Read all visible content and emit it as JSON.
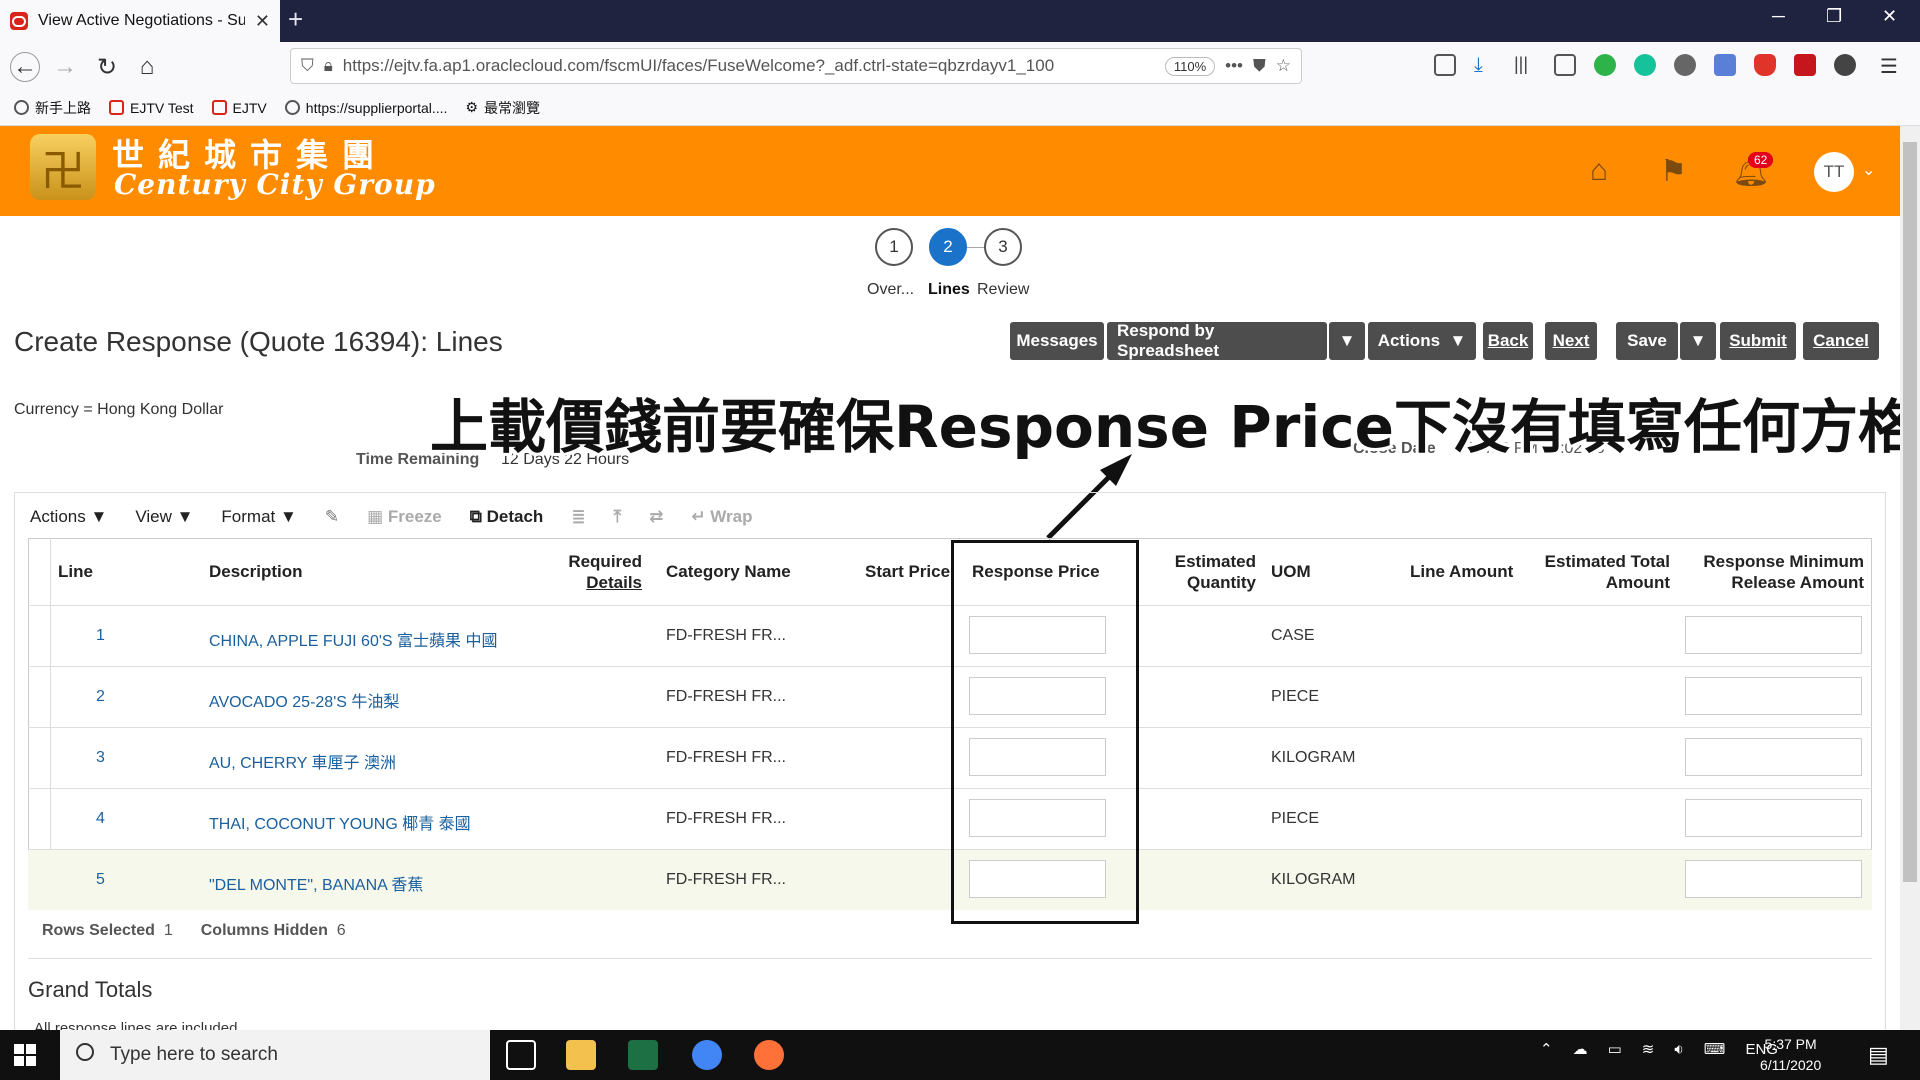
{
  "browser": {
    "tab_title": "View Active Negotiations - Sup",
    "url": "https://ejtv.fa.ap1.oraclecloud.com/fscmUI/faces/FuseWelcome?_adf.ctrl-state=qbzrdayv1_100",
    "zoom": "110%",
    "bookmarks": [
      "新手上路",
      "EJTV Test",
      "EJTV",
      "https://supplierportal....",
      "最常瀏覽"
    ]
  },
  "header": {
    "logo_cn": "世紀城市集團",
    "logo_en": "Century City Group",
    "notifications": "62",
    "user_initials": "TT",
    "brand_color": "#ff8c00"
  },
  "train": {
    "steps": [
      {
        "num": "1",
        "label": "Over..."
      },
      {
        "num": "2",
        "label": "Lines"
      },
      {
        "num": "3",
        "label": "Review"
      }
    ]
  },
  "page": {
    "title": "Create Response (Quote 16394): Lines",
    "currency": "Currency = Hong Kong Dollar",
    "time_remaining_label": "Time Remaining",
    "time_remaining": "12 Days 22 Hours",
    "close_date_label": "Close Date",
    "close_date": "24/6/20 PM 04:02:48",
    "annotation": "上載價錢前要確保Response Price下沒有填寫任何方格"
  },
  "buttons": {
    "messages": "Messages",
    "respond_by_spreadsheet": "Respond by Spreadsheet",
    "actions": "Actions",
    "back": "Back",
    "next": "Next",
    "save": "Save",
    "submit": "Submit",
    "cancel": "Cancel"
  },
  "toolbar": {
    "actions": "Actions",
    "view": "View",
    "format": "Format",
    "freeze": "Freeze",
    "detach": "Detach",
    "wrap": "Wrap"
  },
  "table": {
    "columns": {
      "line": "Line",
      "description": "Description",
      "required_details_1": "Required",
      "required_details_2": "Details",
      "category": "Category Name",
      "start_price": "Start Price",
      "response_price": "Response Price",
      "est_qty_1": "Estimated",
      "est_qty_2": "Quantity",
      "uom": "UOM",
      "line_amount": "Line Amount",
      "est_total_1": "Estimated Total",
      "est_total_2": "Amount",
      "rmra_1": "Response Minimum",
      "rmra_2": "Release Amount"
    },
    "rows": [
      {
        "line": "1",
        "description": "CHINA, APPLE FUJI 60'S 富士蘋果 中國",
        "category": "FD-FRESH FR...",
        "uom": "CASE"
      },
      {
        "line": "2",
        "description": "AVOCADO 25-28'S 牛油梨",
        "category": "FD-FRESH FR...",
        "uom": "PIECE"
      },
      {
        "line": "3",
        "description": "AU, CHERRY 車厘子 澳洲",
        "category": "FD-FRESH FR...",
        "uom": "KILOGRAM"
      },
      {
        "line": "4",
        "description": "THAI, COCONUT YOUNG 椰青 泰國",
        "category": "FD-FRESH FR...",
        "uom": "PIECE"
      },
      {
        "line": "5",
        "description": "\"DEL MONTE\", BANANA 香蕉",
        "category": "FD-FRESH FR...",
        "uom": "KILOGRAM"
      }
    ],
    "rows_selected_label": "Rows Selected",
    "rows_selected": "1",
    "columns_hidden_label": "Columns Hidden",
    "columns_hidden": "6"
  },
  "grand_totals": {
    "title": "Grand Totals",
    "note": "All response lines are included"
  },
  "taskbar": {
    "search_placeholder": "Type here to search",
    "lang": "ENG",
    "time": "5:37 PM",
    "date": "6/11/2020"
  }
}
